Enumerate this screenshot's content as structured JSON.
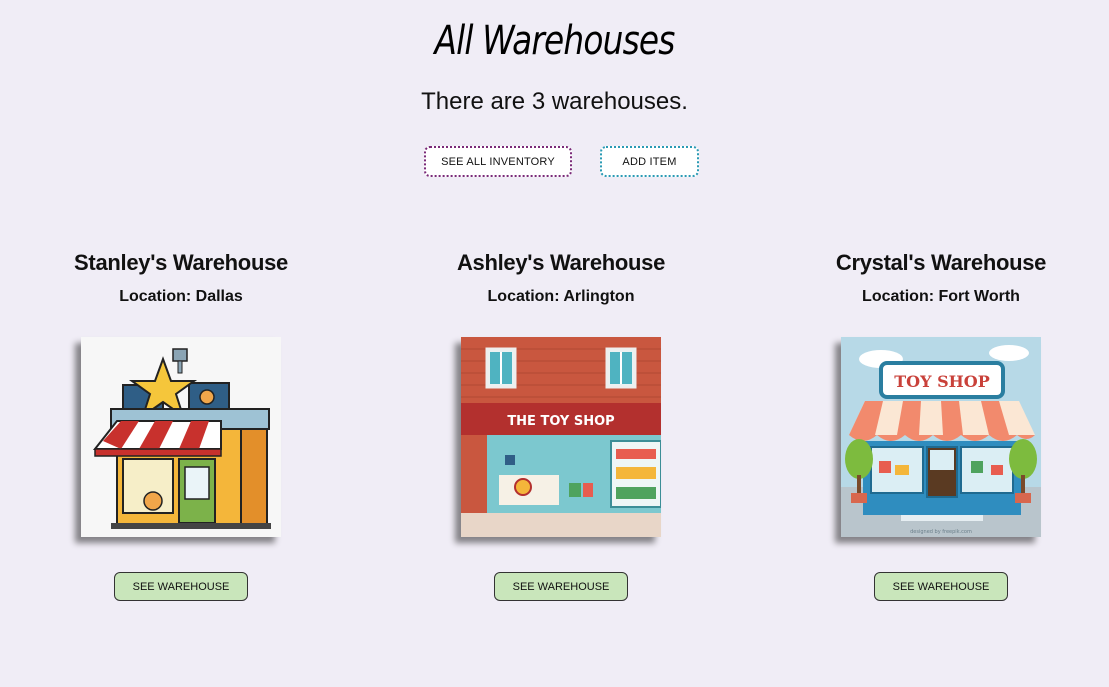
{
  "page": {
    "title": "All Warehouses",
    "subtitle": "There are 3 warehouses."
  },
  "actions": {
    "see_all_inventory": "SEE ALL INVENTORY",
    "add_item": "ADD ITEM"
  },
  "warehouses": [
    {
      "name": "Stanley's Warehouse",
      "location": "Location: Dallas",
      "button": "SEE WAREHOUSE"
    },
    {
      "name": "Ashley's Warehouse",
      "location": "Location: Arlington",
      "button": "SEE WAREHOUSE",
      "sign_text": "THE TOY SHOP"
    },
    {
      "name": "Crystal's Warehouse",
      "location": "Location: Fort Worth",
      "button": "SEE WAREHOUSE",
      "sign_text": "TOY SHOP",
      "image_credit": "designed by freepik.com"
    }
  ],
  "colors": {
    "background": "#f0edf6",
    "inventory_border": "#7a2a78",
    "add_border": "#2a9ab4",
    "warehouse_button": "#c9e6bb"
  }
}
